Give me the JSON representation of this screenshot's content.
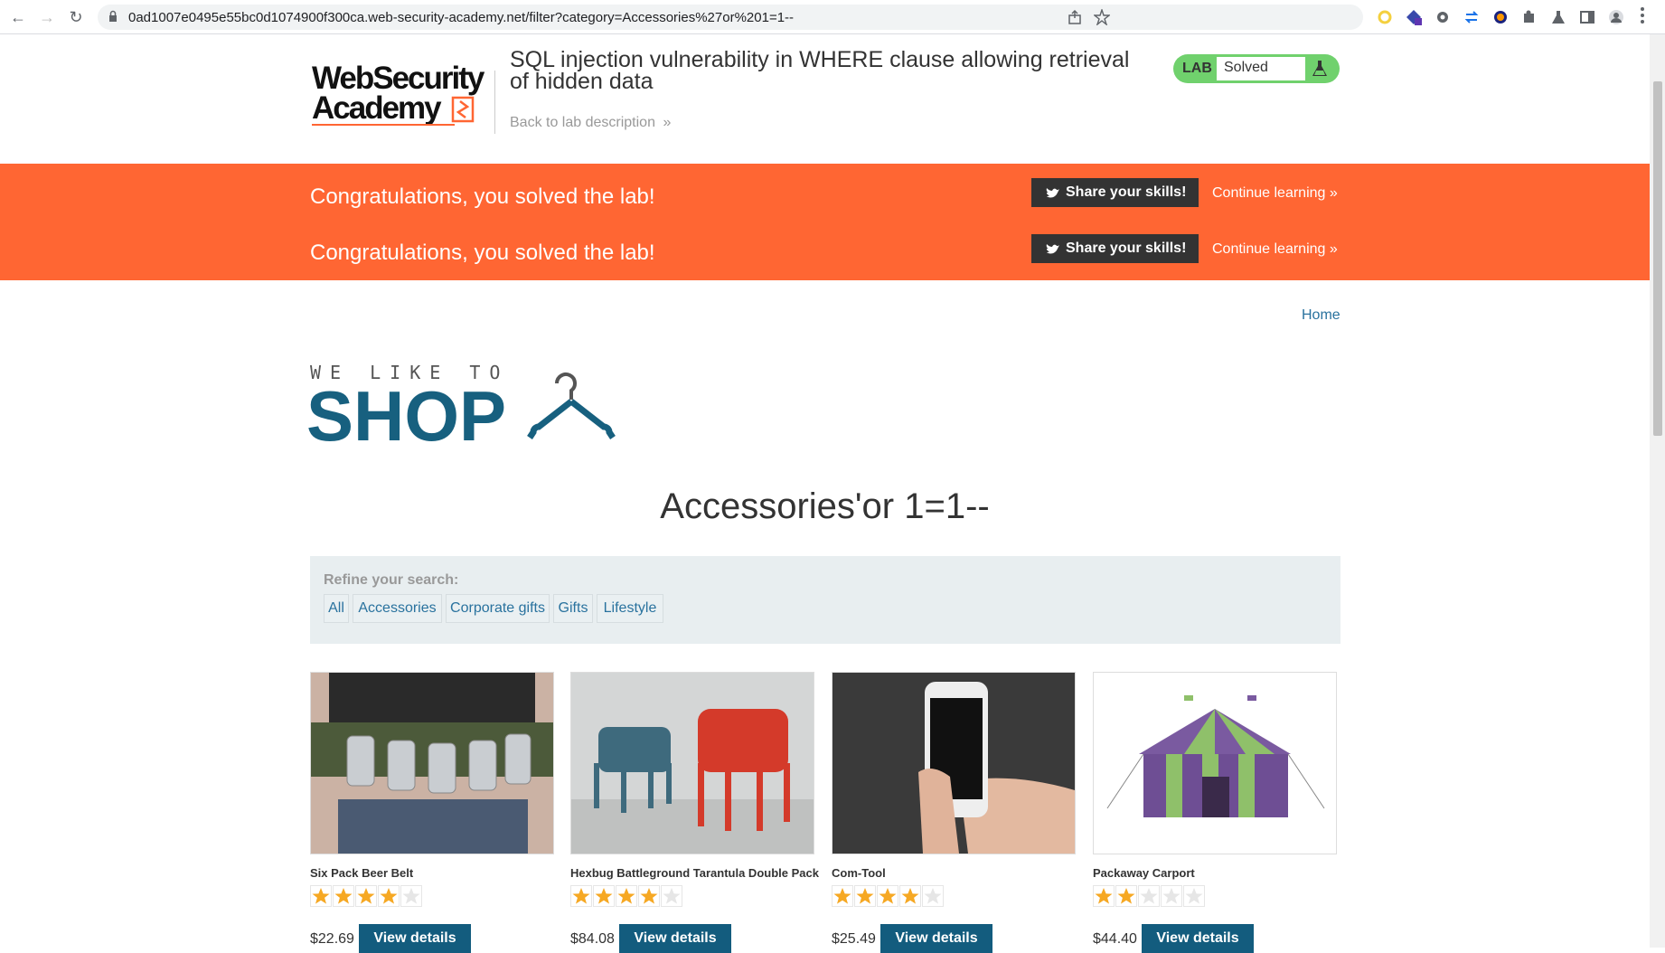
{
  "browser": {
    "url": "0ad1007e0495e55bc0d1074900f300ca.web-security-academy.net/filter?category=Accessories%27or%201=1--"
  },
  "header": {
    "logo_line1": "WebSecurity",
    "logo_line2": "Academy",
    "lab_title": "SQL injection vulnerability in WHERE clause allowing retrieval of hidden data",
    "back_link": "Back to lab description",
    "lab_badge": "LAB",
    "lab_status": "Solved"
  },
  "banner": {
    "rows": [
      {
        "message": "Congratulations, you solved the lab!",
        "share": "Share your skills!",
        "continue": "Continue learning"
      },
      {
        "message": "Congratulations, you solved the lab!",
        "share": "Share your skills!",
        "continue": "Continue learning"
      }
    ]
  },
  "nav": {
    "home": "Home"
  },
  "shop": {
    "tagline": "WE LIKE TO",
    "word": "SHOP"
  },
  "heading": "Accessories'or 1=1--",
  "filter": {
    "label": "Refine your search:",
    "links": [
      "All",
      "Accessories",
      "Corporate gifts",
      "Gifts",
      "Lifestyle"
    ]
  },
  "products": [
    {
      "name": "Six Pack Beer Belt",
      "rating": 4,
      "price": "$22.69",
      "button": "View details",
      "image_icon": "beer-belt-image"
    },
    {
      "name": "Hexbug Battleground Tarantula Double Pack",
      "rating": 4,
      "price": "$84.08",
      "button": "View details",
      "image_icon": "hexbug-image"
    },
    {
      "name": "Com-Tool",
      "rating": 4,
      "price": "$25.49",
      "button": "View details",
      "image_icon": "phone-image"
    },
    {
      "name": "Packaway Carport",
      "rating": 2,
      "price": "$44.40",
      "button": "View details",
      "image_icon": "tent-image"
    }
  ],
  "colors": {
    "banner": "#ff6633",
    "brand_blue": "#17607f",
    "link": "#29729e",
    "star": "#f6a823",
    "lab_green": "#70d16d"
  }
}
